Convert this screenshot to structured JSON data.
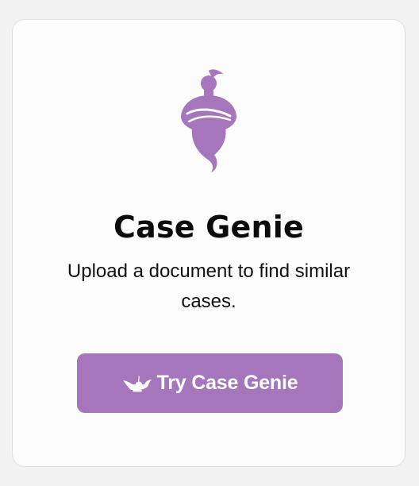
{
  "card": {
    "title": "Case Genie",
    "description": "Upload a document to find similar cases.",
    "button_label": "Try Case Genie"
  },
  "icons": {
    "hero": "genie-icon",
    "button": "magic-lamp-icon"
  },
  "colors": {
    "accent": "#a676bc",
    "page_background": "#f2f2f2",
    "card_background": "#fcfcfc",
    "text": "#0b0b0b",
    "button_text": "#ffffff"
  }
}
